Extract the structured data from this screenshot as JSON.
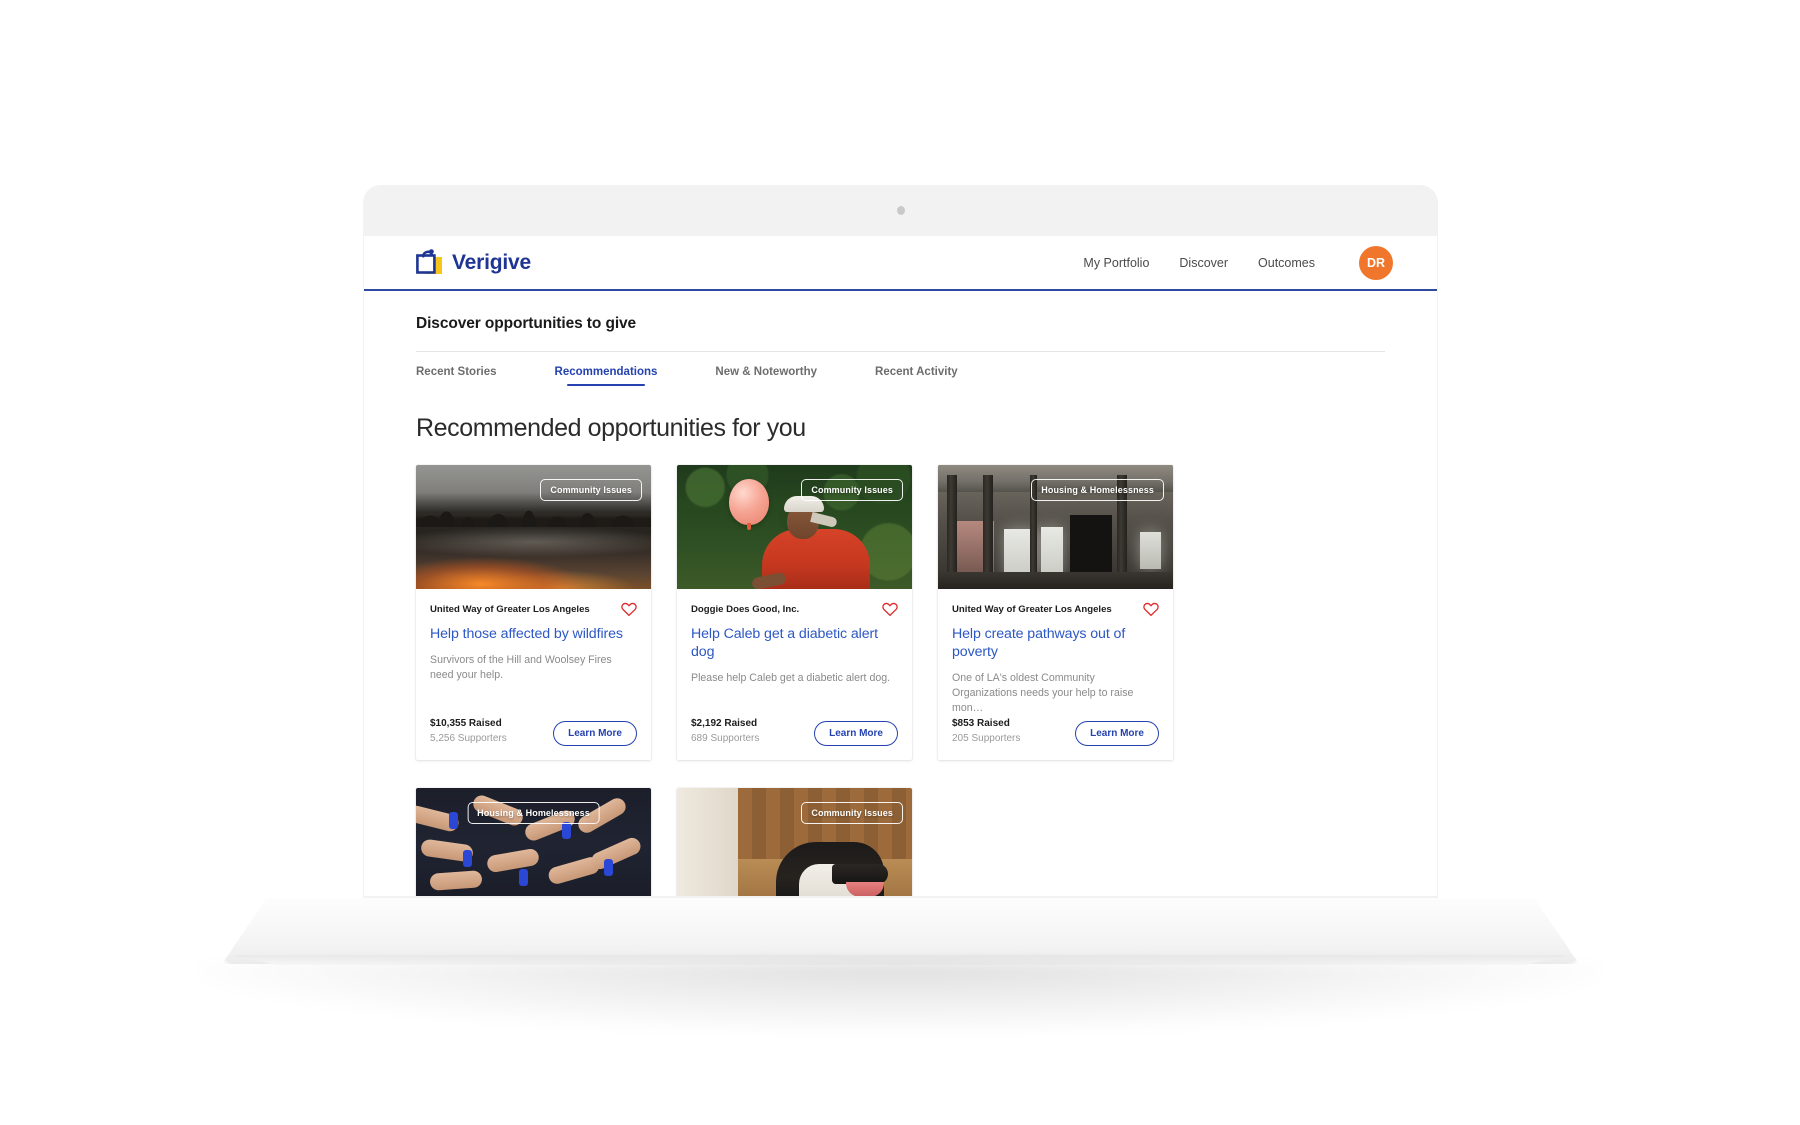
{
  "brand": {
    "name": "Verigive",
    "logo_icon": "verigive-bag-icon",
    "primary_color": "#1f3594",
    "accent_color": "#f0762b"
  },
  "header": {
    "nav": [
      {
        "label": "My Portfolio"
      },
      {
        "label": "Discover"
      },
      {
        "label": "Outcomes"
      }
    ],
    "avatar_initials": "DR"
  },
  "page": {
    "title": "Discover opportunities to give",
    "tabs": [
      {
        "label": "Recent Stories",
        "active": false
      },
      {
        "label": "Recommendations",
        "active": true
      },
      {
        "label": "New & Noteworthy",
        "active": false
      },
      {
        "label": "Recent Activity",
        "active": false
      }
    ],
    "section_heading": "Recommended opportunities for you",
    "learn_more_label": "Learn More",
    "favorite_icon": "heart-icon"
  },
  "cards": [
    {
      "badge": "Community Issues",
      "org": "United Way of Greater Los Angeles",
      "title": "Help those affected by wildfires",
      "description": "Survivors of the Hill and Woolsey Fires need your help.",
      "raised": "$10,355 Raised",
      "supporters": "5,256 Supporters",
      "button": "Learn More",
      "image_alt": "wildfire-glow-over-misty-lake"
    },
    {
      "badge": "Community Issues",
      "org": "Doggie Does Good, Inc.",
      "title": "Help Caleb get a diabetic alert dog",
      "description": "Please help Caleb get a diabetic alert dog.",
      "raised": "$2,192 Raised",
      "supporters": "689 Supporters",
      "button": "Learn More",
      "image_alt": "boy-in-red-shirt-with-pink-balloon"
    },
    {
      "badge": "Housing & Homelessness",
      "org": "United Way of Greater Los Angeles",
      "title": "Help create pathways out of poverty",
      "description": "One of LA's oldest Community Organizations needs your help to raise mon…",
      "raised": "$853 Raised",
      "supporters": "205 Supporters",
      "button": "Learn More",
      "image_alt": "derelict-building-interior"
    },
    {
      "badge": "Housing & Homelessness",
      "org": "",
      "title": "",
      "description": "",
      "raised": "",
      "supporters": "",
      "button": "",
      "image_alt": "hands-together-with-blue-wristbands"
    },
    {
      "badge": "Community Issues",
      "org": "",
      "title": "",
      "description": "",
      "raised": "",
      "supporters": "",
      "button": "",
      "image_alt": "border-collie-dog-on-wood-floor"
    }
  ]
}
